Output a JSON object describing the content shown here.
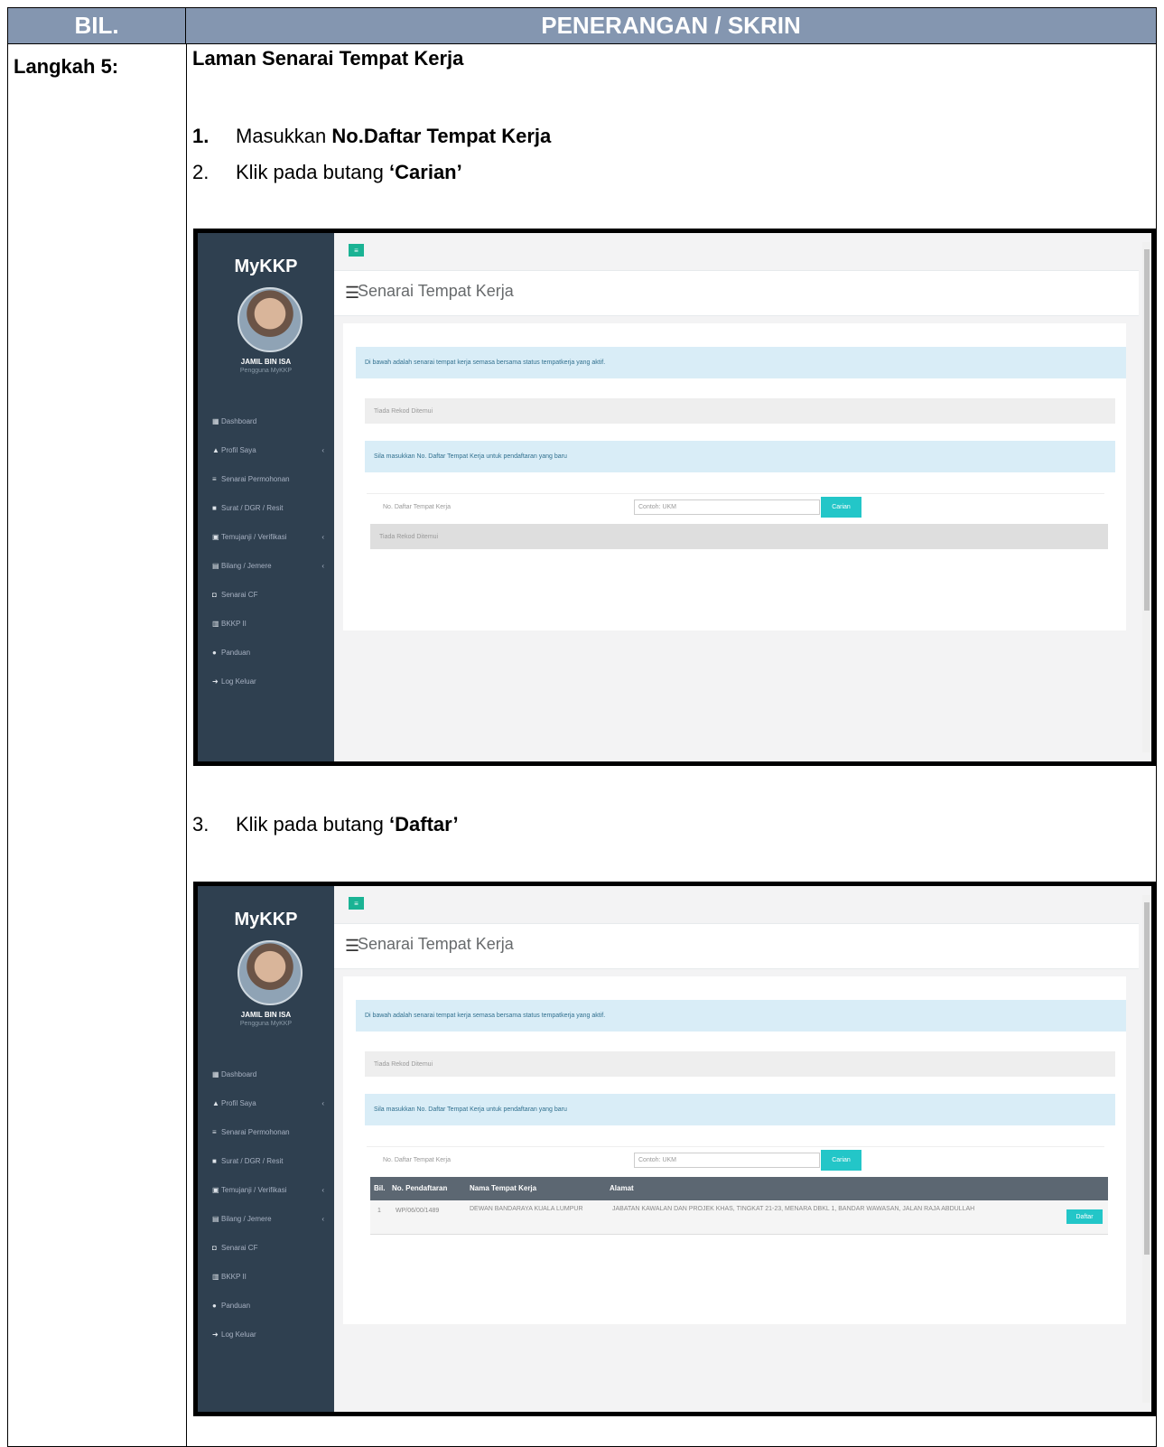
{
  "header": {
    "col1": "BIL.",
    "col2": "PENERANGAN / SKRIN"
  },
  "step_label": "Langkah 5:",
  "section_title": "Laman Senarai Tempat Kerja",
  "instructions": [
    {
      "num": "1.",
      "text": "Masukkan ",
      "bold": "No.Daftar Tempat Kerja"
    },
    {
      "num": "2.",
      "text": "Klik pada butang ",
      "bold": "‘Carian’"
    },
    {
      "num": "3.",
      "text": "Klik pada butang ",
      "bold": "‘Daftar’"
    }
  ],
  "app": {
    "brand": "MyKKP",
    "user_name": "JAMIL BIN ISA",
    "user_role": "Pengguna MyKKP",
    "toggle_icon": "hamburger-icon",
    "page_title": "Senarai Tempat Kerja",
    "menu": [
      {
        "icon": "dashboard-icon",
        "label": "Dashboard",
        "caret": false
      },
      {
        "icon": "user-icon",
        "label": "Profil Saya",
        "caret": true
      },
      {
        "icon": "list-icon",
        "label": "Senarai Permohonan",
        "caret": false
      },
      {
        "icon": "mail-icon",
        "label": "Surat / DGR / Resit",
        "caret": false
      },
      {
        "icon": "calendar-icon",
        "label": "Temujanji / Verifikasi",
        "caret": true
      },
      {
        "icon": "table-icon",
        "label": "Bilang / Jemere",
        "caret": true
      },
      {
        "icon": "cv-icon",
        "label": "Senarai CF",
        "caret": false
      },
      {
        "icon": "report-icon",
        "label": "BKKP II",
        "caret": false
      },
      {
        "icon": "guide-icon",
        "label": "Panduan",
        "caret": false
      },
      {
        "icon": "logout-icon",
        "label": "Log Keluar",
        "caret": false
      }
    ],
    "alert_info": "Di bawah adalah senarai tempat kerja semasa bersama status tempatkerja yang aktif.",
    "no_record": "Tiada Rekod Ditemui",
    "alert_enter": "Sila masukkan No. Daftar Tempat Kerja untuk pendaftaran yang baru",
    "search_label": "No. Daftar Tempat Kerja",
    "search_placeholder": "Contoh: UKM",
    "search_button": "Carian",
    "results_columns": [
      "Bil.",
      "No. Pendaftaran",
      "Nama Tempat Kerja",
      "Alamat"
    ],
    "results_rows": [
      {
        "bil": "1",
        "no": "WP/06/00/1489",
        "nama": "DEWAN BANDARAYA KUALA LUMPUR",
        "alamat": "JABATAN KAWALAN DAN PROJEK KHAS, TINGKAT 21-23, MENARA DBKL 1, BANDAR WAWASAN, JALAN RAJA ABDULLAH",
        "action": "Daftar"
      }
    ]
  }
}
